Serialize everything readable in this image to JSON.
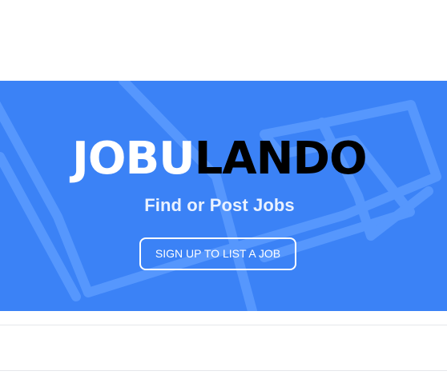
{
  "hero": {
    "brand_part_1": "JOBU",
    "brand_part_2": "LANDO",
    "subtitle": "Find or Post Jobs",
    "cta_label": "SIGN UP TO LIST A JOB"
  },
  "colors": {
    "hero_background": "#3b82f6",
    "hero_pattern": "#5b9bff",
    "brand_primary": "#ffffff",
    "brand_secondary": "#000000"
  }
}
